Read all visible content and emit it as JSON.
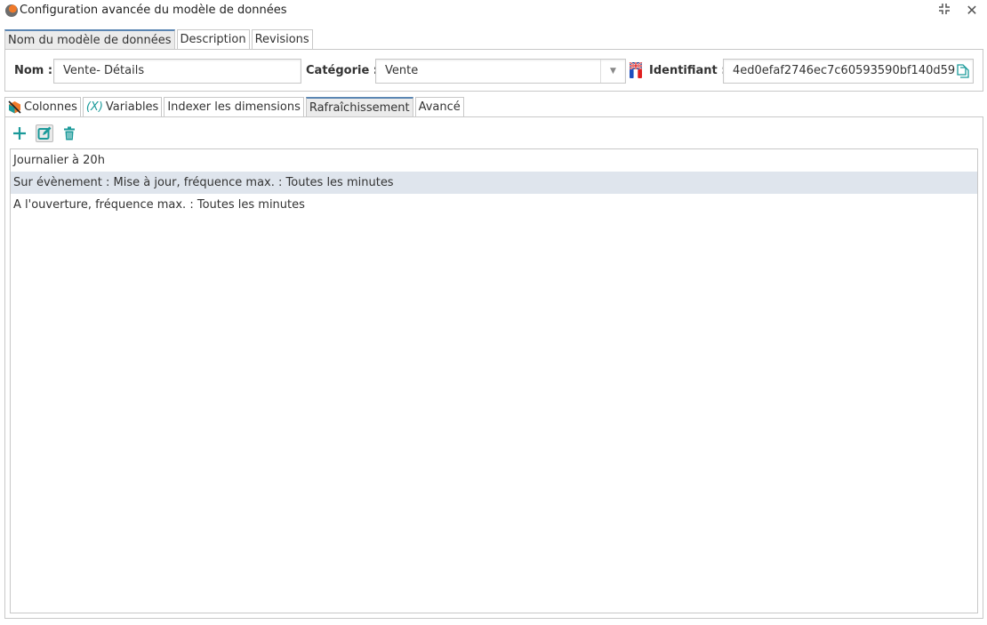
{
  "window": {
    "title": "Configuration avancée du modèle de données",
    "collapse_icon": "⧽⧼",
    "close_icon": "✕"
  },
  "top_tabs": [
    {
      "label": "Nom du modèle de données",
      "active": true
    },
    {
      "label": "Description",
      "active": false
    },
    {
      "label": "Revisions",
      "active": false
    }
  ],
  "form": {
    "name_label": "Nom :",
    "name_value": "Vente- Détails",
    "category_label": "Catégorie :",
    "category_value": "Vente",
    "identifier_label": "Identifiant :",
    "identifier_value": "4ed0efaf2746ec7c60593590bf140d59"
  },
  "section_tabs": [
    {
      "label": "Colonnes",
      "icon": "columns-cube-icon",
      "active": false
    },
    {
      "label": "Variables",
      "icon": "variable-x-icon",
      "icon_text": "(X)",
      "active": false
    },
    {
      "label": "Indexer les dimensions",
      "active": false
    },
    {
      "label": "Rafraîchissement",
      "active": true
    },
    {
      "label": "Avancé",
      "active": false
    }
  ],
  "toolbar": {
    "add": "+",
    "accent_color": "#1a9a9a"
  },
  "refresh_list": [
    {
      "label": "Journalier à 20h",
      "selected": false
    },
    {
      "label": "Sur évènement : Mise à jour, fréquence max. : Toutes les minutes",
      "selected": true
    },
    {
      "label": "A l'ouverture, fréquence max. : Toutes les minutes",
      "selected": false
    }
  ]
}
